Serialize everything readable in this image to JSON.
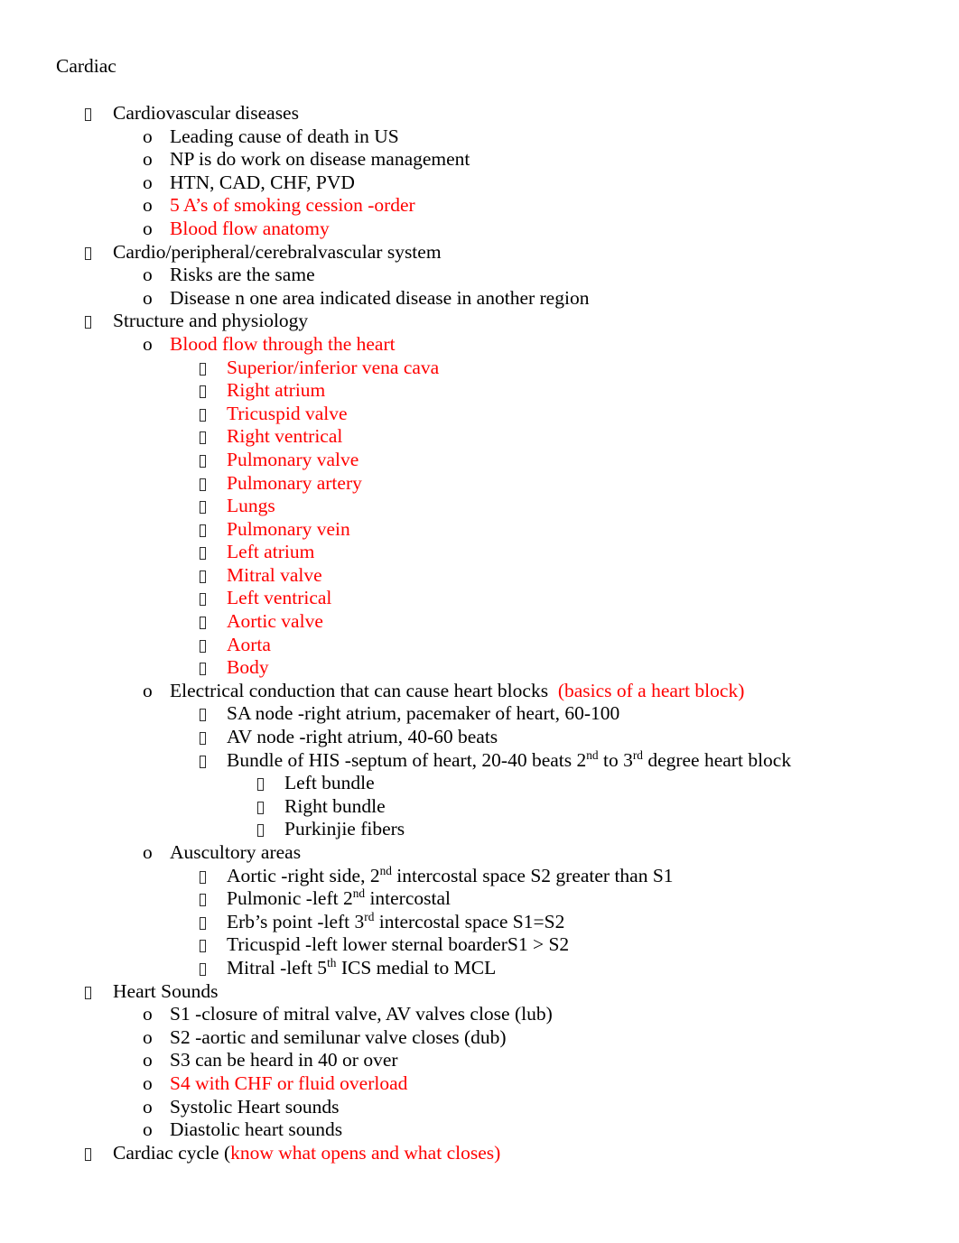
{
  "document": {
    "title": "Cardiac",
    "accent_color": "#FF0000",
    "text_color": "#000000",
    "marker_level1": "tofu-box",
    "marker_level2": "o",
    "marker_level3": "tofu-box",
    "marker_level4": "tofu-box"
  },
  "outline": [
    {
      "level": 1,
      "marker": "box",
      "color": "black",
      "text": "Cardiovascular diseases"
    },
    {
      "level": 2,
      "marker": "o",
      "color": "black",
      "text": "Leading cause of death in US"
    },
    {
      "level": 2,
      "marker": "o",
      "color": "black",
      "text": "NP is do work on disease management"
    },
    {
      "level": 2,
      "marker": "o",
      "color": "black",
      "text": "HTN, CAD, CHF, PVD"
    },
    {
      "level": 2,
      "marker": "o",
      "color": "red",
      "text": "5 A’s of smoking cession -order"
    },
    {
      "level": 2,
      "marker": "o",
      "color": "red",
      "text": "Blood flow anatomy"
    },
    {
      "level": 1,
      "marker": "box",
      "color": "black",
      "text": "Cardio/peripheral/cerebralvascular system"
    },
    {
      "level": 2,
      "marker": "o",
      "color": "black",
      "text": "Risks are the same"
    },
    {
      "level": 2,
      "marker": "o",
      "color": "black",
      "text": "Disease n one area indicated disease in another region"
    },
    {
      "level": 1,
      "marker": "box",
      "color": "black",
      "text": "Structure and physiology"
    },
    {
      "level": 2,
      "marker": "o",
      "color": "red",
      "text": "Blood flow through the heart"
    },
    {
      "level": 3,
      "marker": "box",
      "color": "red",
      "text": "Superior/inferior vena cava"
    },
    {
      "level": 3,
      "marker": "box",
      "color": "red",
      "text": "Right atrium"
    },
    {
      "level": 3,
      "marker": "box",
      "color": "red",
      "text": "Tricuspid valve"
    },
    {
      "level": 3,
      "marker": "box",
      "color": "red",
      "text": "Right ventrical"
    },
    {
      "level": 3,
      "marker": "box",
      "color": "red",
      "text": "Pulmonary valve"
    },
    {
      "level": 3,
      "marker": "box",
      "color": "red",
      "text": "Pulmonary artery"
    },
    {
      "level": 3,
      "marker": "box",
      "color": "red",
      "text": "Lungs"
    },
    {
      "level": 3,
      "marker": "box",
      "color": "red",
      "text": "Pulmonary vein"
    },
    {
      "level": 3,
      "marker": "box",
      "color": "red",
      "text": "Left atrium"
    },
    {
      "level": 3,
      "marker": "box",
      "color": "red",
      "text": "Mitral valve"
    },
    {
      "level": 3,
      "marker": "box",
      "color": "red",
      "text": "Left ventrical"
    },
    {
      "level": 3,
      "marker": "box",
      "color": "red",
      "text": "Aortic valve"
    },
    {
      "level": 3,
      "marker": "box",
      "color": "red",
      "text": "Aorta"
    },
    {
      "level": 3,
      "marker": "box",
      "color": "red",
      "text": "Body"
    },
    {
      "level": 2,
      "marker": "o",
      "color": "mixed",
      "html": "<span class=\"blk\">Electrical conduction that can cause heart blocks</span><span class=\"blk\">  </span><span class=\"red\">(basics of a heart block)</span>",
      "text": "Electrical conduction that can cause heart blocks  (basics of a heart block)"
    },
    {
      "level": 3,
      "marker": "box",
      "color": "black",
      "text": "SA node -right atrium, pacemaker of heart, 60-100"
    },
    {
      "level": 3,
      "marker": "box",
      "color": "black",
      "text": "AV node -right atrium, 40-60 beats"
    },
    {
      "level": 3,
      "marker": "box",
      "color": "black",
      "html": "Bundle of HIS -septum of heart, 20-40 beats 2<sup>nd</sup> to 3<sup>rd</sup> degree heart block",
      "text": "Bundle of HIS -septum of heart, 20-40 beats 2nd to 3rd degree heart block"
    },
    {
      "level": 4,
      "marker": "box",
      "color": "black",
      "text": "Left bundle"
    },
    {
      "level": 4,
      "marker": "box",
      "color": "black",
      "text": "Right bundle"
    },
    {
      "level": 4,
      "marker": "box",
      "color": "black",
      "text": "Purkinjie fibers"
    },
    {
      "level": 2,
      "marker": "o",
      "color": "black",
      "text": "Auscultory areas"
    },
    {
      "level": 3,
      "marker": "box",
      "color": "black",
      "html": "Aortic -right side, 2<sup>nd</sup> intercostal space S2 greater than S1",
      "text": "Aortic -right side, 2nd intercostal space S2 greater than S1"
    },
    {
      "level": 3,
      "marker": "box",
      "color": "black",
      "html": "Pulmonic -left 2<sup>nd</sup> intercostal",
      "text": "Pulmonic -left 2nd intercostal"
    },
    {
      "level": 3,
      "marker": "box",
      "color": "black",
      "html": "Erb’s point -left 3<sup>rd</sup> intercostal space S1=S2",
      "text": "Erb’s point -left 3rd intercostal space S1=S2"
    },
    {
      "level": 3,
      "marker": "box",
      "color": "black",
      "text": "Tricuspid -left lower sternal boarderS1 > S2"
    },
    {
      "level": 3,
      "marker": "box",
      "color": "black",
      "html": "Mitral -left 5<sup>th</sup> ICS medial to MCL",
      "text": "Mitral -left 5th ICS medial to MCL"
    },
    {
      "level": 1,
      "marker": "box",
      "color": "black",
      "text": "Heart Sounds"
    },
    {
      "level": 2,
      "marker": "o",
      "color": "black",
      "text": "S1 -closure of mitral valve, AV valves close (lub)"
    },
    {
      "level": 2,
      "marker": "o",
      "color": "black",
      "text": "S2 -aortic and semilunar valve closes (dub)"
    },
    {
      "level": 2,
      "marker": "o",
      "color": "black",
      "text": "S3 can be heard in 40 or over"
    },
    {
      "level": 2,
      "marker": "o",
      "color": "red",
      "text": "S4 with CHF or fluid overload"
    },
    {
      "level": 2,
      "marker": "o",
      "color": "black",
      "text": "Systolic Heart sounds"
    },
    {
      "level": 2,
      "marker": "o",
      "color": "black",
      "text": "Diastolic heart sounds"
    },
    {
      "level": 1,
      "marker": "box",
      "color": "mixed",
      "html": "<span class=\"blk\">Cardiac cycle (</span><span class=\"red\">know what opens and what closes)</span>",
      "text": "Cardiac cycle (know what opens and what closes)"
    }
  ]
}
